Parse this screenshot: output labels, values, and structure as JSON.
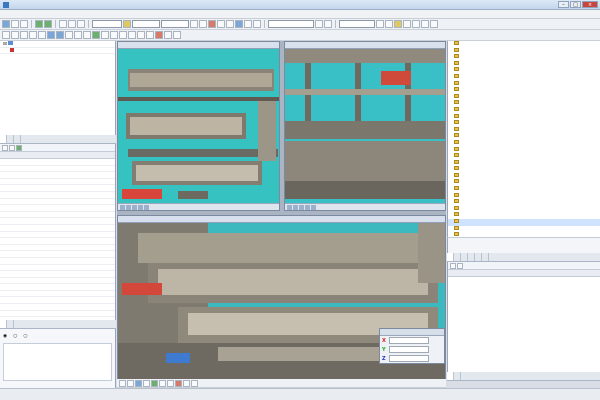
{
  "window": {
    "title": ""
  },
  "menu": [],
  "toolbar": {
    "layer_combo": "",
    "view_combo": "",
    "style_combo": "",
    "options_combo": "",
    "scale_combo": ""
  },
  "model_tree": {
    "root": "",
    "child": ""
  },
  "left_tabs": [],
  "attr_grid": {
    "col_attr": "",
    "col_value": "",
    "rows": [
      {
        "a": "",
        "v": ""
      },
      {
        "a": "",
        "v": ""
      },
      {
        "a": "",
        "v": ""
      },
      {
        "a": "",
        "v": ""
      },
      {
        "a": "",
        "v": ""
      },
      {
        "a": "",
        "v": ""
      },
      {
        "a": "",
        "v": ""
      },
      {
        "a": "",
        "v": ""
      },
      {
        "a": "",
        "v": ""
      },
      {
        "a": "",
        "v": ""
      },
      {
        "a": "",
        "v": ""
      },
      {
        "a": "",
        "v": ""
      },
      {
        "a": "",
        "v": ""
      },
      {
        "a": "",
        "v": ""
      },
      {
        "a": "",
        "v": ""
      },
      {
        "a": "",
        "v": ""
      },
      {
        "a": "",
        "v": ""
      },
      {
        "a": "",
        "v": ""
      },
      {
        "a": "",
        "v": ""
      },
      {
        "a": "",
        "v": ""
      },
      {
        "a": "",
        "v": ""
      },
      {
        "a": "",
        "v": ""
      },
      {
        "a": "",
        "v": ""
      },
      {
        "a": "",
        "v": ""
      },
      {
        "a": "",
        "v": ""
      },
      {
        "a": "",
        "v": ""
      }
    ]
  },
  "bottom_left_tabs": [],
  "select_label": "",
  "radio_options": [],
  "viewports": [
    {
      "title": ""
    },
    {
      "title": ""
    },
    {
      "title": ""
    }
  ],
  "coords": {
    "title": "",
    "x": "",
    "y": "",
    "z": ""
  },
  "right_tree": [
    "",
    "",
    "",
    "",
    "",
    "",
    "",
    "",
    "",
    "",
    "",
    "",
    "",
    "",
    "",
    "",
    "",
    "",
    "",
    "",
    "",
    "",
    "",
    "",
    "",
    "",
    "",
    "",
    "",
    "",
    "",
    "",
    ""
  ],
  "right_info": {
    "line1": "",
    "line2": ""
  },
  "right_tabs": [],
  "right_grid_cols": [
    "",
    ""
  ],
  "right_bottom_tabs": [],
  "status": {
    "left": "",
    "coords": ""
  }
}
